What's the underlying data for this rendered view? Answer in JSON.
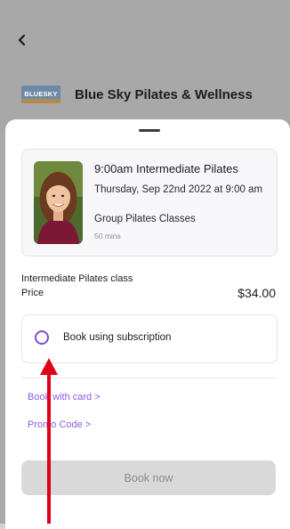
{
  "header": {
    "studio_name": "Blue Sky Pilates & Wellness",
    "logo_text": "BLUESKY"
  },
  "class_card": {
    "time_title": "9:00am Intermediate Pilates",
    "date": "Thursday, Sep 22nd 2022 at 9:00 am",
    "category": "Group Pilates Classes",
    "duration": "50 mins"
  },
  "pricing": {
    "item_name": "Intermediate Pilates class",
    "price_label": "Price",
    "price_value": "$34.00"
  },
  "options": {
    "subscription_label": "Book using subscription",
    "subscription_selected": false,
    "book_with_card": "Book with card >",
    "promo_code": "Promo Code >"
  },
  "actions": {
    "book_now": "Book now",
    "book_now_enabled": false
  },
  "colors": {
    "accent": "#7b4fd6",
    "link": "#8e5ae6",
    "annotation_arrow": "#e0001a"
  }
}
